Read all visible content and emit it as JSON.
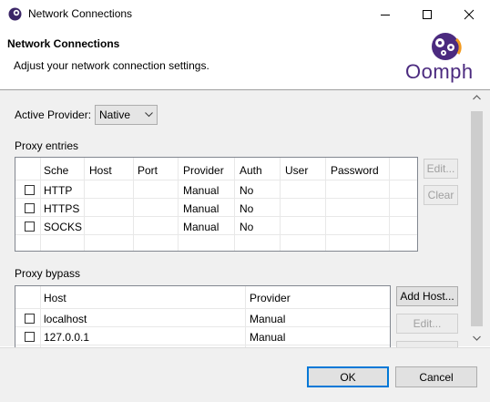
{
  "window": {
    "title": "Network Connections"
  },
  "header": {
    "title": "Network Connections",
    "subtitle": "Adjust your network connection settings.",
    "logo_text": "Oomph"
  },
  "provider": {
    "label": "Active Provider:",
    "value": "Native"
  },
  "proxy_entries": {
    "label": "Proxy entries",
    "columns": [
      "Sche",
      "Host",
      "Port",
      "Provider",
      "Auth",
      "User",
      "Password"
    ],
    "rows": [
      {
        "scheme": "HTTP",
        "host": "",
        "port": "",
        "provider": "Manual",
        "auth": "No",
        "user": "",
        "password": ""
      },
      {
        "scheme": "HTTPS",
        "host": "",
        "port": "",
        "provider": "Manual",
        "auth": "No",
        "user": "",
        "password": ""
      },
      {
        "scheme": "SOCKS",
        "host": "",
        "port": "",
        "provider": "Manual",
        "auth": "No",
        "user": "",
        "password": ""
      }
    ],
    "edit_label": "Edit...",
    "clear_label": "Clear"
  },
  "proxy_bypass": {
    "label": "Proxy bypass",
    "columns": [
      "Host",
      "Provider"
    ],
    "rows": [
      {
        "host": "localhost",
        "provider": "Manual"
      },
      {
        "host": "127.0.0.1",
        "provider": "Manual"
      }
    ],
    "add_host_label": "Add Host...",
    "edit_label": "Edit..."
  },
  "footer": {
    "ok_label": "OK",
    "cancel_label": "Cancel"
  },
  "colors": {
    "accent": "#0078d7",
    "logo_purple": "#4b2a7f",
    "logo_orange": "#f39a1e"
  }
}
